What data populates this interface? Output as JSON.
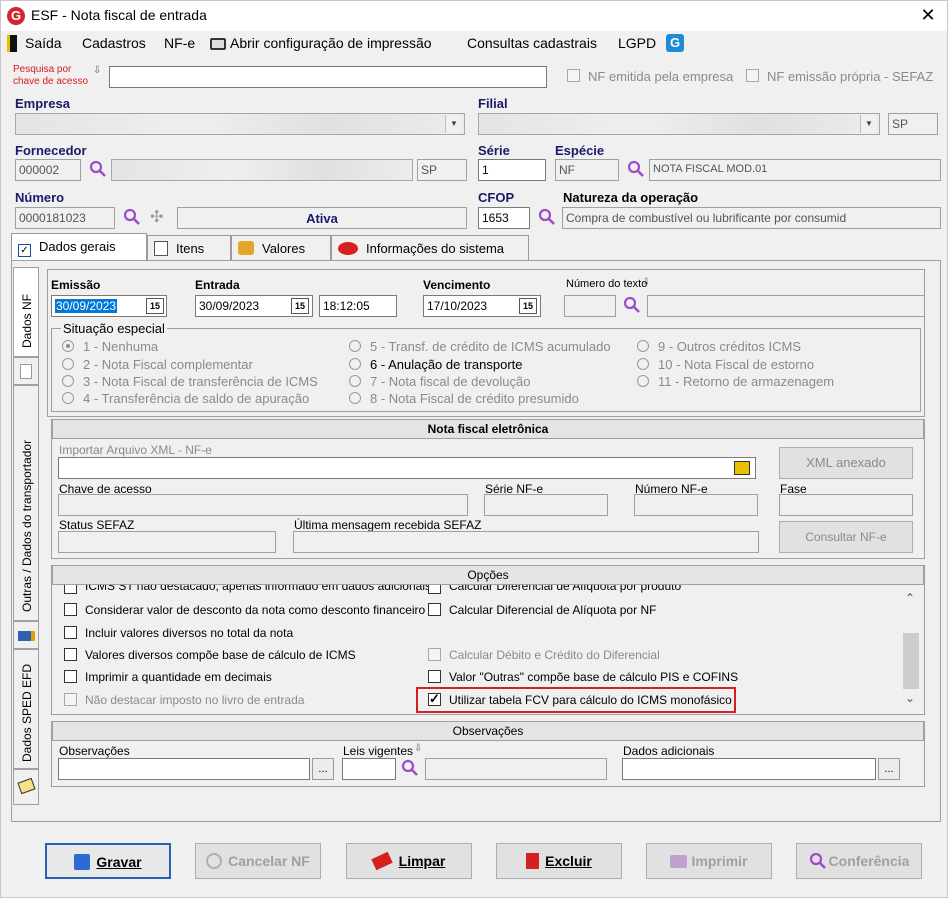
{
  "window": {
    "title": "ESF - Nota fiscal de entrada",
    "close": "✕"
  },
  "menu": [
    "Saída",
    "Cadastros",
    "NF-e",
    "Abrir configuração de impressão",
    "Consultas cadastrais",
    "LGPD"
  ],
  "search": {
    "label_line1": "Pesquisa por",
    "label_line2": "chave de acesso",
    "value": ""
  },
  "top_checks": {
    "emitida_empresa": "NF emitida pela empresa",
    "emissao_propria": "NF emissão própria - SEFAZ"
  },
  "empresa": {
    "label": "Empresa",
    "value": ""
  },
  "filial": {
    "label": "Filial",
    "value": "",
    "uf": "SP"
  },
  "fornecedor": {
    "label": "Fornecedor",
    "code": "000002",
    "name": "",
    "uf": "SP"
  },
  "serie": {
    "label": "Série",
    "value": "1"
  },
  "especie": {
    "label": "Espécie",
    "code": "NF",
    "desc": "NOTA FISCAL MOD.01"
  },
  "numero": {
    "label": "Número",
    "value": "0000181023",
    "status": "Ativa"
  },
  "cfop": {
    "label": "CFOP",
    "value": "1653"
  },
  "natureza": {
    "label": "Natureza da operação",
    "value": "Compra de combustível ou lubrificante por consumid"
  },
  "tabs": [
    "Dados gerais",
    "Itens",
    "Valores",
    "Informações do sistema"
  ],
  "side_tabs": [
    "Dados NF",
    "Outras / Dados do transportador",
    "Dados SPED EFD"
  ],
  "dates": {
    "emissao_label": "Emissão",
    "emissao": "30/09/2023",
    "entrada_label": "Entrada",
    "entrada": "30/09/2023",
    "hora": "18:12:05",
    "vencimento_label": "Vencimento",
    "vencimento": "17/10/2023",
    "numero_texto_label": "Número do texto",
    "cal_icon": "15"
  },
  "situacao": {
    "label": "Situação especial",
    "options": [
      "1 - Nenhuma",
      "2 - Nota Fiscal complementar",
      "3 - Nota Fiscal de transferência de ICMS",
      "4 - Transferência de saldo de apuração",
      "5 - Transf. de crédito de ICMS acumulado",
      "6 - Anulação de transporte",
      "7 - Nota fiscal de devolução",
      "8 - Nota Fiscal de crédito presumido",
      "9 - Outros créditos ICMS",
      "10 - Nota Fiscal de estorno",
      "11 - Retorno de armazenagem"
    ]
  },
  "nfe": {
    "title": "Nota fiscal eletrônica",
    "importar_label": "Importar Arquivo XML - NF-e",
    "xml_button": "XML anexado",
    "chave_label": "Chave de acesso",
    "serie_label": "Série NF-e",
    "numero_label": "Número NF-e",
    "fase_label": "Fase",
    "status_label": "Status SEFAZ",
    "msg_label": "Última mensagem recebida SEFAZ",
    "consultar_button": "Consultar NF-e"
  },
  "opcoes": {
    "title": "Opções",
    "cut_left": "ICMS ST não destacado, apenas informado em dados adicionais",
    "cut_right": "Calcular Diferencial de Alíquota por produto",
    "left": [
      "Considerar valor de desconto da nota como desconto financeiro",
      "Incluir valores diversos no total da nota",
      "Valores diversos compõe base de cálculo de ICMS",
      "Imprimir a quantidade em decimais",
      "Não destacar imposto no livro de entrada"
    ],
    "right": [
      "Calcular Diferencial de Alíquota por NF",
      "Calcular Débito e Crédito do Diferencial",
      "Valor \"Outras\" compõe base de cálculo PIS e COFINS",
      "Utilizar tabela FCV para cálculo do ICMS monofásico"
    ]
  },
  "observacoes": {
    "title": "Observações",
    "obs_label": "Observações",
    "leis_label": "Leis vigentes",
    "dados_label": "Dados adicionais",
    "dots": "..."
  },
  "buttons": [
    "Gravar",
    "Cancelar NF",
    "Limpar",
    "Excluir",
    "Imprimir",
    "Conferência"
  ],
  "colors": {
    "highlight_box": "#d42020",
    "primary_border": "#2b5fb3",
    "selected_text_bg": "#0078d7"
  }
}
